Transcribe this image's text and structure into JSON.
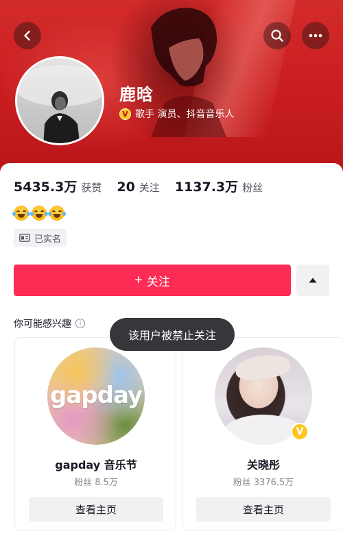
{
  "header": {
    "back_icon": "chevron-left-icon",
    "search_icon": "search-icon",
    "more_icon": "more-dots-icon"
  },
  "profile": {
    "name": "鹿晗",
    "verified_badge": "V",
    "verification": "歌手 演员、抖音音乐人",
    "stats": [
      {
        "value": "5435.3万",
        "label": "获赞"
      },
      {
        "value": "20",
        "label": "关注"
      },
      {
        "value": "1137.3万",
        "label": "粉丝"
      }
    ],
    "real_name_tag": "已实名"
  },
  "actions": {
    "follow_label": "关注",
    "follow_plus": "+"
  },
  "recommend": {
    "title": "你可能感兴趣",
    "cards": [
      {
        "name": "gapday 音乐节",
        "fans": "粉丝 8.5万",
        "button": "查看主页",
        "logo_text": "gapday"
      },
      {
        "name": "关晓彤",
        "fans": "粉丝 3376.5万",
        "button": "查看主页",
        "badge": "V"
      }
    ]
  },
  "toast": {
    "message": "该用户被禁止关注"
  },
  "colors": {
    "accent": "#fe2c55",
    "banner": "#c81d1f",
    "verified": "#fbc51f"
  }
}
